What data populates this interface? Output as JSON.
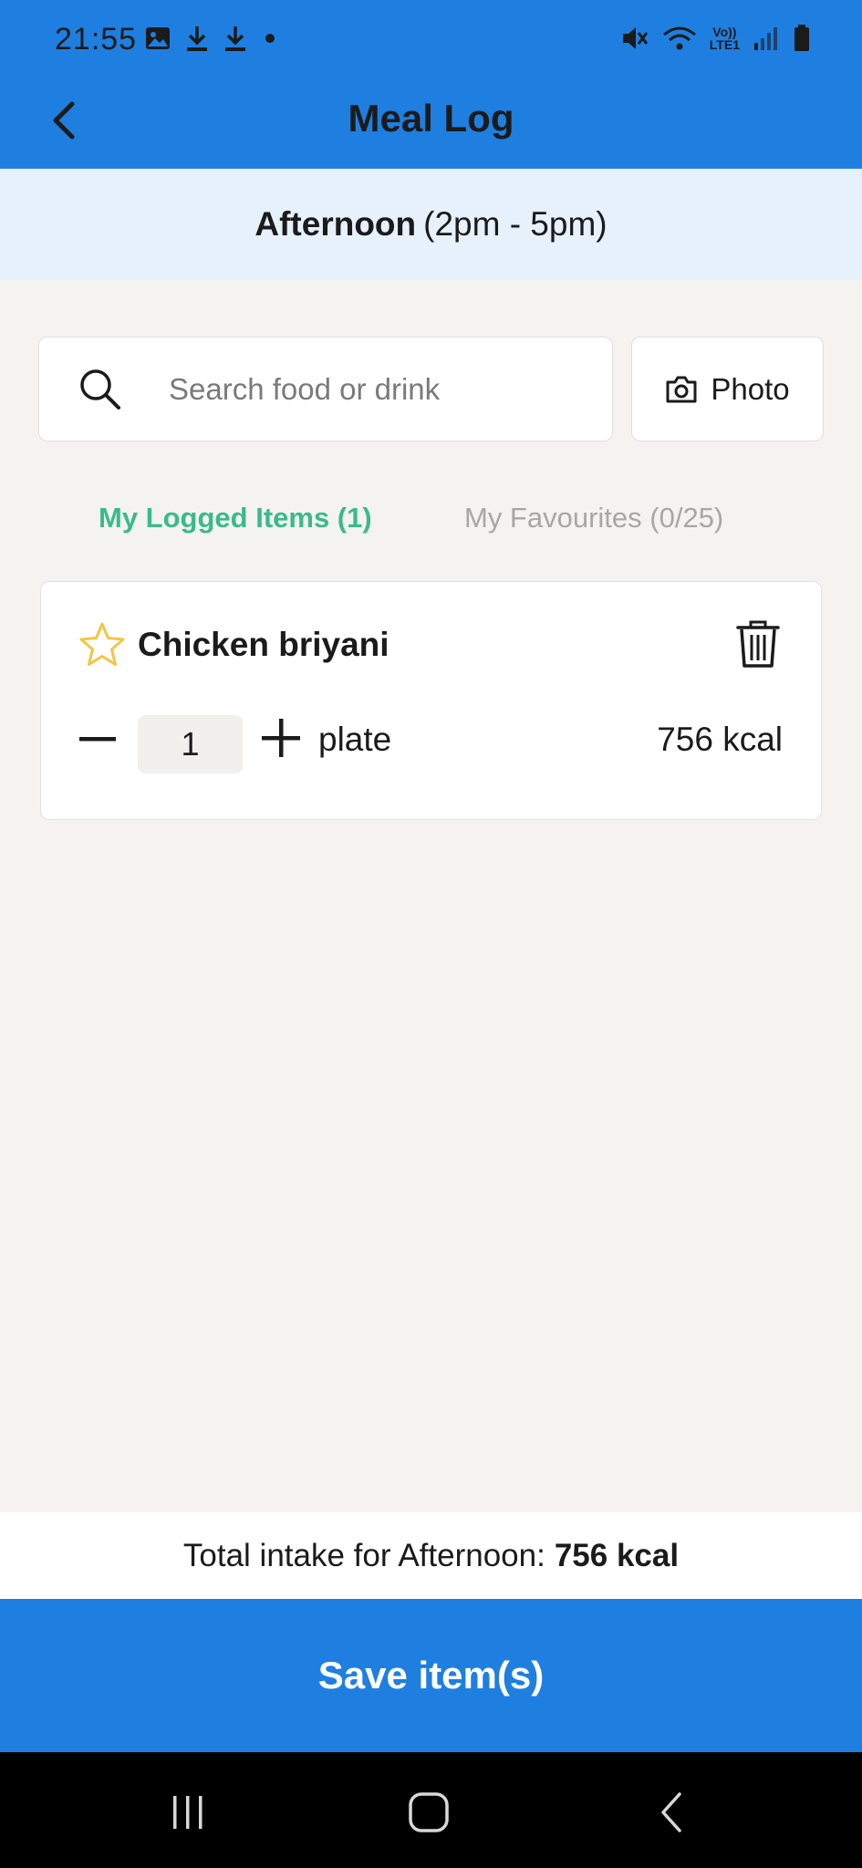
{
  "status_bar": {
    "time": "21:55",
    "left_icons": [
      "image-icon",
      "download-icon",
      "download-icon",
      "dot-icon"
    ],
    "right_icons": [
      "mute-icon",
      "wifi-icon",
      "volte-icon",
      "signal-icon",
      "battery-icon"
    ],
    "volte_text_top": "Vo))",
    "volte_text_bottom": "LTE1"
  },
  "header": {
    "title": "Meal Log"
  },
  "period": {
    "name": "Afternoon",
    "range": "(2pm - 5pm)"
  },
  "search": {
    "placeholder": "Search food or drink",
    "value": ""
  },
  "photo_button": {
    "label": "Photo"
  },
  "tabs": [
    {
      "label": "My Logged Items (1)",
      "active": true
    },
    {
      "label": "My Favourites (0/25)",
      "active": false
    }
  ],
  "logged_items": [
    {
      "name": "Chicken briyani",
      "quantity": "1",
      "unit": "plate",
      "calories": "756 kcal",
      "favourite": false
    }
  ],
  "total": {
    "label": "Total intake for Afternoon:",
    "value": "756 kcal"
  },
  "save_button": {
    "label": "Save item(s)"
  },
  "colors": {
    "primary": "#1f7fe0",
    "active_tab": "#3bba8b",
    "inactive_tab": "#a7a7a7",
    "star": "#f2c744",
    "background": "#f4f3f0",
    "period_banner": "#e6f1fb"
  }
}
